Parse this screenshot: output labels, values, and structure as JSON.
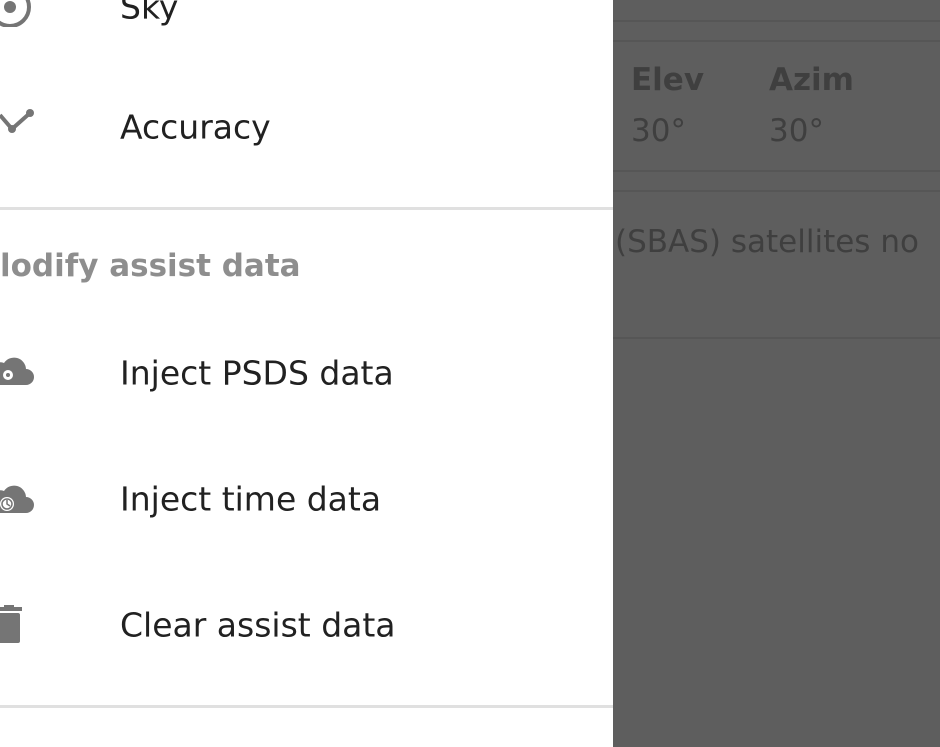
{
  "background": {
    "columns": [
      {
        "header": "Elev",
        "value": "30°"
      },
      {
        "header": "Azim",
        "value": "30°"
      }
    ],
    "notice": "(SBAS) satellites no"
  },
  "drawer": {
    "top_items": [
      {
        "label": "Sky",
        "icon": "sky-icon"
      },
      {
        "label": "Accuracy",
        "icon": "accuracy-icon"
      }
    ],
    "section_header": "lodify assist data",
    "assist_items": [
      {
        "label": "Inject PSDS data",
        "icon": "cloud-gear-icon"
      },
      {
        "label": "Inject time data",
        "icon": "cloud-clock-icon"
      },
      {
        "label": "Clear assist data",
        "icon": "trash-icon"
      }
    ]
  },
  "colors": {
    "scrim_background": "#5e5e5e",
    "drawer_background": "#ffffff",
    "icon": "#757575",
    "label": "#212121",
    "section_header": "#8e8e8e"
  }
}
